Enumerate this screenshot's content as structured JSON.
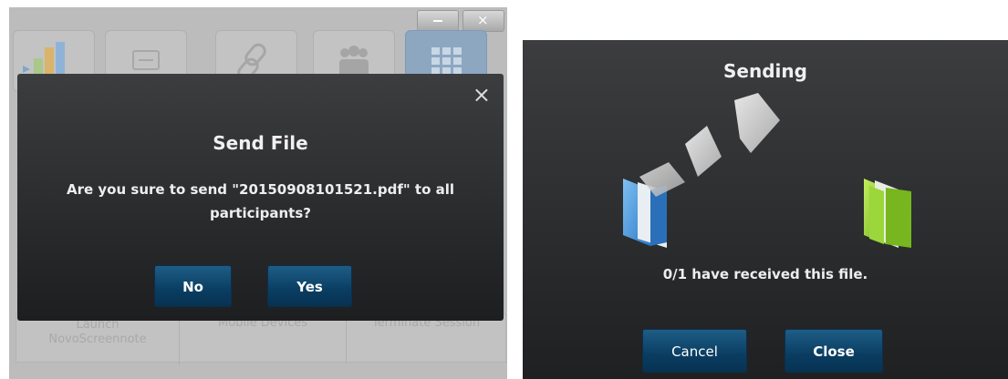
{
  "background_app": {
    "window_controls": {
      "minimize_icon": "minimize-icon",
      "close_icon": "close-icon",
      "close_glyph": "×"
    },
    "toolbar_tiles": [
      {
        "icon": "presentation-chart-icon"
      },
      {
        "icon": "screen-share-icon"
      },
      {
        "icon": "link-icon"
      },
      {
        "icon": "participants-icon"
      },
      {
        "icon": "apps-grid-icon"
      }
    ],
    "bottom_actions": {
      "launch_line1": "Launch",
      "launch_line2": "NovoScreennote",
      "mobile_devices": "Mobile Devices",
      "terminate_session": "Terminate Session"
    }
  },
  "send_file_dialog": {
    "close_glyph": "×",
    "title": "Send File",
    "message": "Are you sure to send \"20150908101521.pdf\" to all participants?",
    "no_label": "No",
    "yes_label": "Yes"
  },
  "sending_dialog": {
    "title": "Sending",
    "status": "0/1 have received this file.",
    "cancel_label": "Cancel",
    "close_label": "Close",
    "colors": {
      "source_folder": "#3f8fdc",
      "target_folder": "#8fcd2a",
      "button": "#0a3d62"
    }
  }
}
